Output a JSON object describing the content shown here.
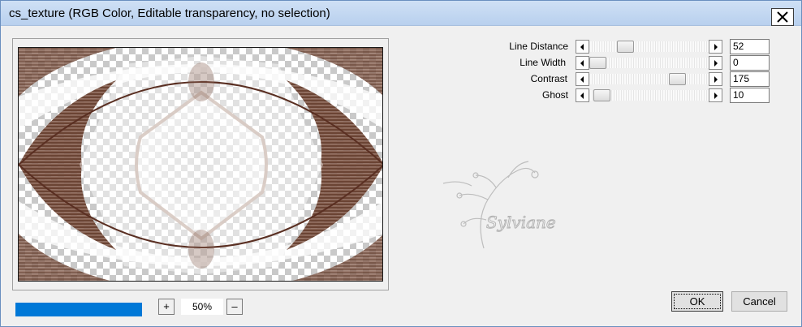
{
  "window": {
    "title": "cs_texture (RGB Color, Editable transparency, no selection)"
  },
  "icons": {
    "close": "close-x-icon",
    "slider_left": "arrow-left-icon",
    "slider_right": "arrow-right-icon",
    "watermark": "floral-signature-icon"
  },
  "preview": {
    "colors": {
      "texture": "#6b4434",
      "checker_dark": "#c9c9c9",
      "checker_light": "#ffffff"
    },
    "zoom": {
      "plus_label": "+",
      "minus_label": "–",
      "value": "50%"
    },
    "progress_color": "#0078d7"
  },
  "params": [
    {
      "label": "Line Distance",
      "value": "52",
      "slider_fraction": 0.27
    },
    {
      "label": "Line Width",
      "value": "0",
      "slider_fraction": 0.0
    },
    {
      "label": "Contrast",
      "value": "175",
      "slider_fraction": 0.78
    },
    {
      "label": "Ghost",
      "value": "10",
      "slider_fraction": 0.04
    }
  ],
  "watermark": {
    "text": "Sylviane"
  },
  "buttons": {
    "ok": "OK",
    "cancel": "Cancel"
  }
}
